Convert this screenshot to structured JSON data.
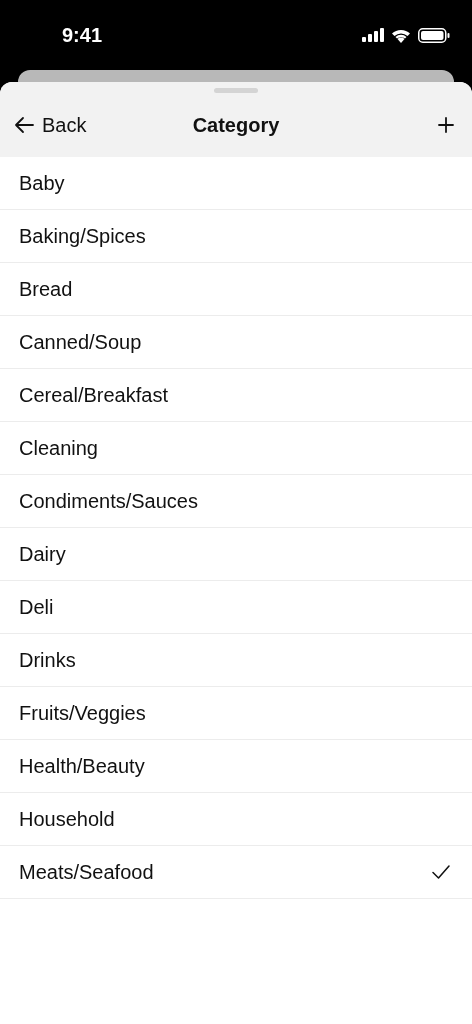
{
  "status_bar": {
    "time": "9:41"
  },
  "header": {
    "back_label": "Back",
    "title": "Category"
  },
  "items": [
    {
      "label": "Baby",
      "selected": false
    },
    {
      "label": "Baking/Spices",
      "selected": false
    },
    {
      "label": "Bread",
      "selected": false
    },
    {
      "label": "Canned/Soup",
      "selected": false
    },
    {
      "label": "Cereal/Breakfast",
      "selected": false
    },
    {
      "label": "Cleaning",
      "selected": false
    },
    {
      "label": "Condiments/Sauces",
      "selected": false
    },
    {
      "label": "Dairy",
      "selected": false
    },
    {
      "label": "Deli",
      "selected": false
    },
    {
      "label": "Drinks",
      "selected": false
    },
    {
      "label": "Fruits/Veggies",
      "selected": false
    },
    {
      "label": "Health/Beauty",
      "selected": false
    },
    {
      "label": "Household",
      "selected": false
    },
    {
      "label": "Meats/Seafood",
      "selected": true
    }
  ]
}
